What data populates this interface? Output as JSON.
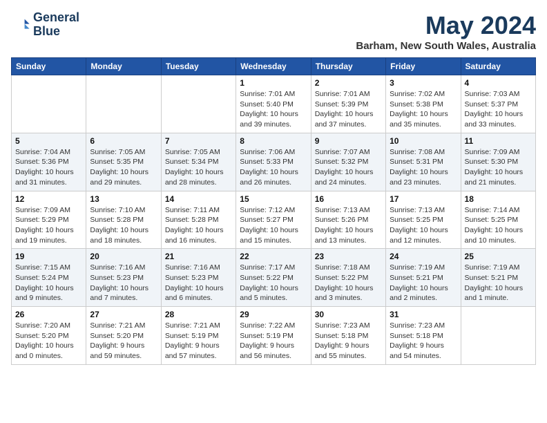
{
  "header": {
    "logo_line1": "General",
    "logo_line2": "Blue",
    "title": "May 2024",
    "subtitle": "Barham, New South Wales, Australia"
  },
  "calendar": {
    "days_of_week": [
      "Sunday",
      "Monday",
      "Tuesday",
      "Wednesday",
      "Thursday",
      "Friday",
      "Saturday"
    ],
    "weeks": [
      [
        {
          "day": "",
          "detail": ""
        },
        {
          "day": "",
          "detail": ""
        },
        {
          "day": "",
          "detail": ""
        },
        {
          "day": "1",
          "detail": "Sunrise: 7:01 AM\nSunset: 5:40 PM\nDaylight: 10 hours\nand 39 minutes."
        },
        {
          "day": "2",
          "detail": "Sunrise: 7:01 AM\nSunset: 5:39 PM\nDaylight: 10 hours\nand 37 minutes."
        },
        {
          "day": "3",
          "detail": "Sunrise: 7:02 AM\nSunset: 5:38 PM\nDaylight: 10 hours\nand 35 minutes."
        },
        {
          "day": "4",
          "detail": "Sunrise: 7:03 AM\nSunset: 5:37 PM\nDaylight: 10 hours\nand 33 minutes."
        }
      ],
      [
        {
          "day": "5",
          "detail": "Sunrise: 7:04 AM\nSunset: 5:36 PM\nDaylight: 10 hours\nand 31 minutes."
        },
        {
          "day": "6",
          "detail": "Sunrise: 7:05 AM\nSunset: 5:35 PM\nDaylight: 10 hours\nand 29 minutes."
        },
        {
          "day": "7",
          "detail": "Sunrise: 7:05 AM\nSunset: 5:34 PM\nDaylight: 10 hours\nand 28 minutes."
        },
        {
          "day": "8",
          "detail": "Sunrise: 7:06 AM\nSunset: 5:33 PM\nDaylight: 10 hours\nand 26 minutes."
        },
        {
          "day": "9",
          "detail": "Sunrise: 7:07 AM\nSunset: 5:32 PM\nDaylight: 10 hours\nand 24 minutes."
        },
        {
          "day": "10",
          "detail": "Sunrise: 7:08 AM\nSunset: 5:31 PM\nDaylight: 10 hours\nand 23 minutes."
        },
        {
          "day": "11",
          "detail": "Sunrise: 7:09 AM\nSunset: 5:30 PM\nDaylight: 10 hours\nand 21 minutes."
        }
      ],
      [
        {
          "day": "12",
          "detail": "Sunrise: 7:09 AM\nSunset: 5:29 PM\nDaylight: 10 hours\nand 19 minutes."
        },
        {
          "day": "13",
          "detail": "Sunrise: 7:10 AM\nSunset: 5:28 PM\nDaylight: 10 hours\nand 18 minutes."
        },
        {
          "day": "14",
          "detail": "Sunrise: 7:11 AM\nSunset: 5:28 PM\nDaylight: 10 hours\nand 16 minutes."
        },
        {
          "day": "15",
          "detail": "Sunrise: 7:12 AM\nSunset: 5:27 PM\nDaylight: 10 hours\nand 15 minutes."
        },
        {
          "day": "16",
          "detail": "Sunrise: 7:13 AM\nSunset: 5:26 PM\nDaylight: 10 hours\nand 13 minutes."
        },
        {
          "day": "17",
          "detail": "Sunrise: 7:13 AM\nSunset: 5:25 PM\nDaylight: 10 hours\nand 12 minutes."
        },
        {
          "day": "18",
          "detail": "Sunrise: 7:14 AM\nSunset: 5:25 PM\nDaylight: 10 hours\nand 10 minutes."
        }
      ],
      [
        {
          "day": "19",
          "detail": "Sunrise: 7:15 AM\nSunset: 5:24 PM\nDaylight: 10 hours\nand 9 minutes."
        },
        {
          "day": "20",
          "detail": "Sunrise: 7:16 AM\nSunset: 5:23 PM\nDaylight: 10 hours\nand 7 minutes."
        },
        {
          "day": "21",
          "detail": "Sunrise: 7:16 AM\nSunset: 5:23 PM\nDaylight: 10 hours\nand 6 minutes."
        },
        {
          "day": "22",
          "detail": "Sunrise: 7:17 AM\nSunset: 5:22 PM\nDaylight: 10 hours\nand 5 minutes."
        },
        {
          "day": "23",
          "detail": "Sunrise: 7:18 AM\nSunset: 5:22 PM\nDaylight: 10 hours\nand 3 minutes."
        },
        {
          "day": "24",
          "detail": "Sunrise: 7:19 AM\nSunset: 5:21 PM\nDaylight: 10 hours\nand 2 minutes."
        },
        {
          "day": "25",
          "detail": "Sunrise: 7:19 AM\nSunset: 5:21 PM\nDaylight: 10 hours\nand 1 minute."
        }
      ],
      [
        {
          "day": "26",
          "detail": "Sunrise: 7:20 AM\nSunset: 5:20 PM\nDaylight: 10 hours\nand 0 minutes."
        },
        {
          "day": "27",
          "detail": "Sunrise: 7:21 AM\nSunset: 5:20 PM\nDaylight: 9 hours\nand 59 minutes."
        },
        {
          "day": "28",
          "detail": "Sunrise: 7:21 AM\nSunset: 5:19 PM\nDaylight: 9 hours\nand 57 minutes."
        },
        {
          "day": "29",
          "detail": "Sunrise: 7:22 AM\nSunset: 5:19 PM\nDaylight: 9 hours\nand 56 minutes."
        },
        {
          "day": "30",
          "detail": "Sunrise: 7:23 AM\nSunset: 5:18 PM\nDaylight: 9 hours\nand 55 minutes."
        },
        {
          "day": "31",
          "detail": "Sunrise: 7:23 AM\nSunset: 5:18 PM\nDaylight: 9 hours\nand 54 minutes."
        },
        {
          "day": "",
          "detail": ""
        }
      ]
    ]
  }
}
